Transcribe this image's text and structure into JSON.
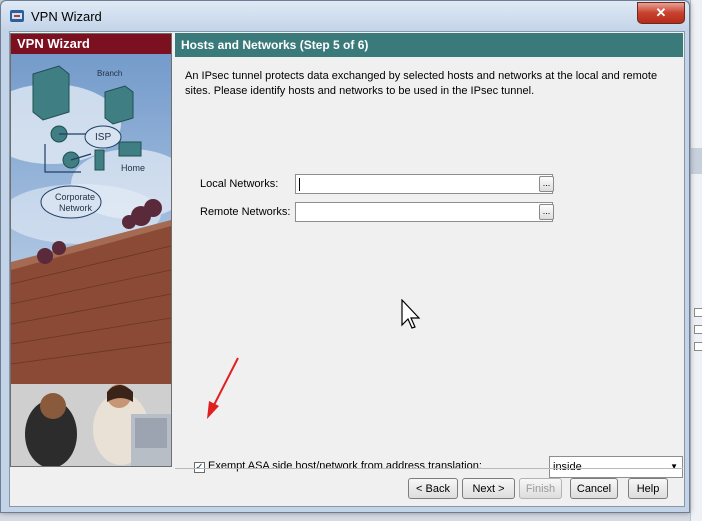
{
  "window": {
    "title": "VPN Wizard",
    "close_glyph": "✕"
  },
  "left_panel": {
    "header": "VPN Wizard",
    "diagram_labels": {
      "branch": "Branch",
      "isp": "ISP",
      "home": "Home",
      "corporate": "Corporate",
      "network": "Network"
    }
  },
  "step": {
    "title": "Hosts and Networks  (Step 5 of 6)",
    "description": "An IPsec tunnel protects data exchanged by selected hosts and networks at the local and remote sites. Please identify hosts and networks to be used in the IPsec tunnel."
  },
  "form": {
    "local_networks_label": "Local Networks:",
    "local_networks_value": "",
    "remote_networks_label": "Remote Networks:",
    "remote_networks_value": "",
    "browse_label": "...",
    "exempt_checked": true,
    "exempt_label": "Exempt ASA side host/network from address translation:",
    "interface_selected": "inside"
  },
  "buttons": {
    "back": "< Back",
    "next": "Next >",
    "finish": "Finish",
    "cancel": "Cancel",
    "help": "Help"
  },
  "icons": {
    "window_icon": "cisco-asdm-icon",
    "browse_icon": "ellipsis-icon",
    "dropdown_icon": "chevron-down-icon",
    "pointer": "mouse-cursor-icon",
    "annotation": "red-arrow-annotation"
  },
  "colors": {
    "header_maroon": "#7a1020",
    "step_header_teal": "#3b7a7a",
    "annotation_red": "#e02020"
  }
}
